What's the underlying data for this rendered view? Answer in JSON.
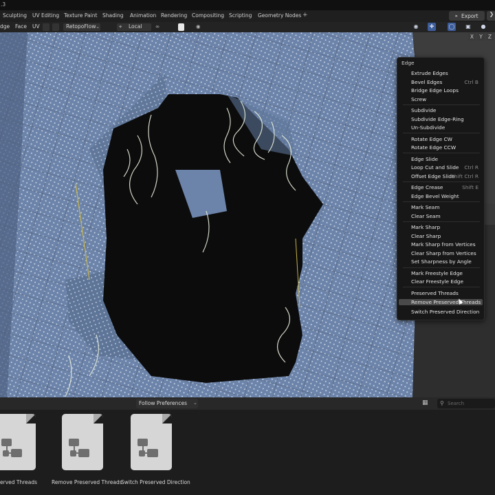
{
  "topbar": {
    "version_fragment": ".3"
  },
  "workspaces": {
    "tabs": [
      "Sculpting",
      "UV Editing",
      "Texture Paint",
      "Shading",
      "Animation",
      "Rendering",
      "Compositing",
      "Scripting",
      "Geometry Nodes"
    ],
    "add_symbol": "+",
    "export_label": "Export"
  },
  "header": {
    "select_modes": [
      "dge",
      "Face"
    ],
    "uv": "UV",
    "addon": "RetopoFlow",
    "orientation": "Local"
  },
  "viewport": {
    "gizmo_axes": [
      "X",
      "Y",
      "Z"
    ]
  },
  "edge_menu": {
    "title": "Edge",
    "items": [
      {
        "label": "Extrude Edges",
        "shortcut": ""
      },
      {
        "label": "Bevel Edges",
        "shortcut": "Ctrl B"
      },
      {
        "label": "Bridge Edge Loops",
        "shortcut": ""
      },
      {
        "label": "Screw",
        "shortcut": ""
      },
      {
        "label": "Subdivide",
        "shortcut": ""
      },
      {
        "label": "Subdivide Edge-Ring",
        "shortcut": ""
      },
      {
        "label": "Un-Subdivide",
        "shortcut": ""
      },
      {
        "label": "Rotate Edge CW",
        "shortcut": ""
      },
      {
        "label": "Rotate Edge CCW",
        "shortcut": ""
      },
      {
        "label": "Edge Slide",
        "shortcut": ""
      },
      {
        "label": "Loop Cut and Slide",
        "shortcut": "Ctrl R"
      },
      {
        "label": "Offset Edge Slide",
        "shortcut": "Shift Ctrl R"
      },
      {
        "label": "Edge Crease",
        "shortcut": "Shift E"
      },
      {
        "label": "Edge Bevel Weight",
        "shortcut": ""
      },
      {
        "label": "Mark Seam",
        "shortcut": ""
      },
      {
        "label": "Clear Seam",
        "shortcut": ""
      },
      {
        "label": "Mark Sharp",
        "shortcut": ""
      },
      {
        "label": "Clear Sharp",
        "shortcut": ""
      },
      {
        "label": "Mark Sharp from Vertices",
        "shortcut": ""
      },
      {
        "label": "Clear Sharp from Vertices",
        "shortcut": ""
      },
      {
        "label": "Set Sharpness by Angle",
        "shortcut": ""
      },
      {
        "label": "Mark Freestyle Edge",
        "shortcut": ""
      },
      {
        "label": "Clear Freestyle Edge",
        "shortcut": ""
      },
      {
        "label": "Preserved Threads",
        "shortcut": ""
      },
      {
        "label": "Remove Preserved Threads",
        "shortcut": ""
      },
      {
        "label": "Switch Preserved Direction",
        "shortcut": ""
      }
    ]
  },
  "asset_browser": {
    "follow_label": "Follow Preferences",
    "search_placeholder": "Search",
    "assets": [
      {
        "label": "erved Threads"
      },
      {
        "label": "Remove Preserved Threads"
      },
      {
        "label": "Switch Preserved Direction"
      }
    ]
  },
  "colors": {
    "menu_bg": "#171717",
    "menu_highlight": "#4a4a4a",
    "fabric": "#6f86ab",
    "hole": "#0d0d0d"
  }
}
